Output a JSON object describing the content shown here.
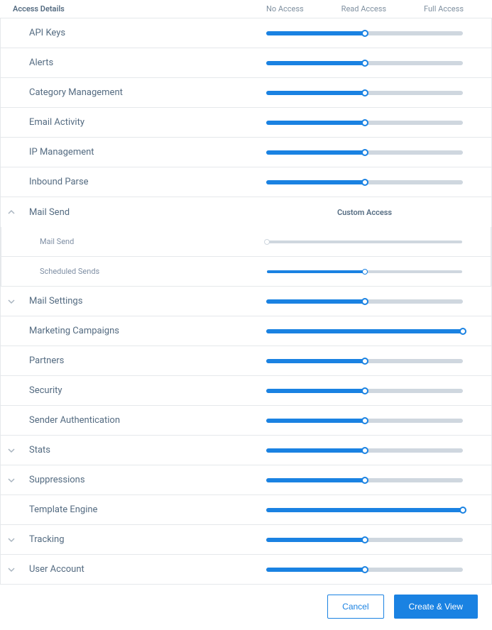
{
  "header": {
    "title": "Access Details",
    "labels": {
      "no": "No Access",
      "read": "Read Access",
      "full": "Full Access"
    }
  },
  "permissions": [
    {
      "label": "API Keys",
      "level": 50,
      "expandable": false
    },
    {
      "label": "Alerts",
      "level": 50,
      "expandable": false
    },
    {
      "label": "Category Management",
      "level": 50,
      "expandable": false
    },
    {
      "label": "Email Activity",
      "level": 50,
      "expandable": false
    },
    {
      "label": "IP Management",
      "level": 50,
      "expandable": false
    },
    {
      "label": "Inbound Parse",
      "level": 50,
      "expandable": false
    }
  ],
  "mail_send": {
    "label": "Mail Send",
    "custom_label": "Custom Access",
    "children": [
      {
        "label": "Mail Send",
        "level": 0
      },
      {
        "label": "Scheduled Sends",
        "level": 50
      }
    ]
  },
  "permissions2": [
    {
      "label": "Mail Settings",
      "level": 50,
      "expandable": true
    },
    {
      "label": "Marketing Campaigns",
      "level": 100,
      "expandable": false
    },
    {
      "label": "Partners",
      "level": 50,
      "expandable": false
    },
    {
      "label": "Security",
      "level": 50,
      "expandable": false
    },
    {
      "label": "Sender Authentication",
      "level": 50,
      "expandable": false
    },
    {
      "label": "Stats",
      "level": 50,
      "expandable": true
    },
    {
      "label": "Suppressions",
      "level": 50,
      "expandable": true
    },
    {
      "label": "Template Engine",
      "level": 100,
      "expandable": false
    },
    {
      "label": "Tracking",
      "level": 50,
      "expandable": true
    },
    {
      "label": "User Account",
      "level": 50,
      "expandable": true
    }
  ],
  "footer": {
    "cancel": "Cancel",
    "create": "Create & View"
  }
}
